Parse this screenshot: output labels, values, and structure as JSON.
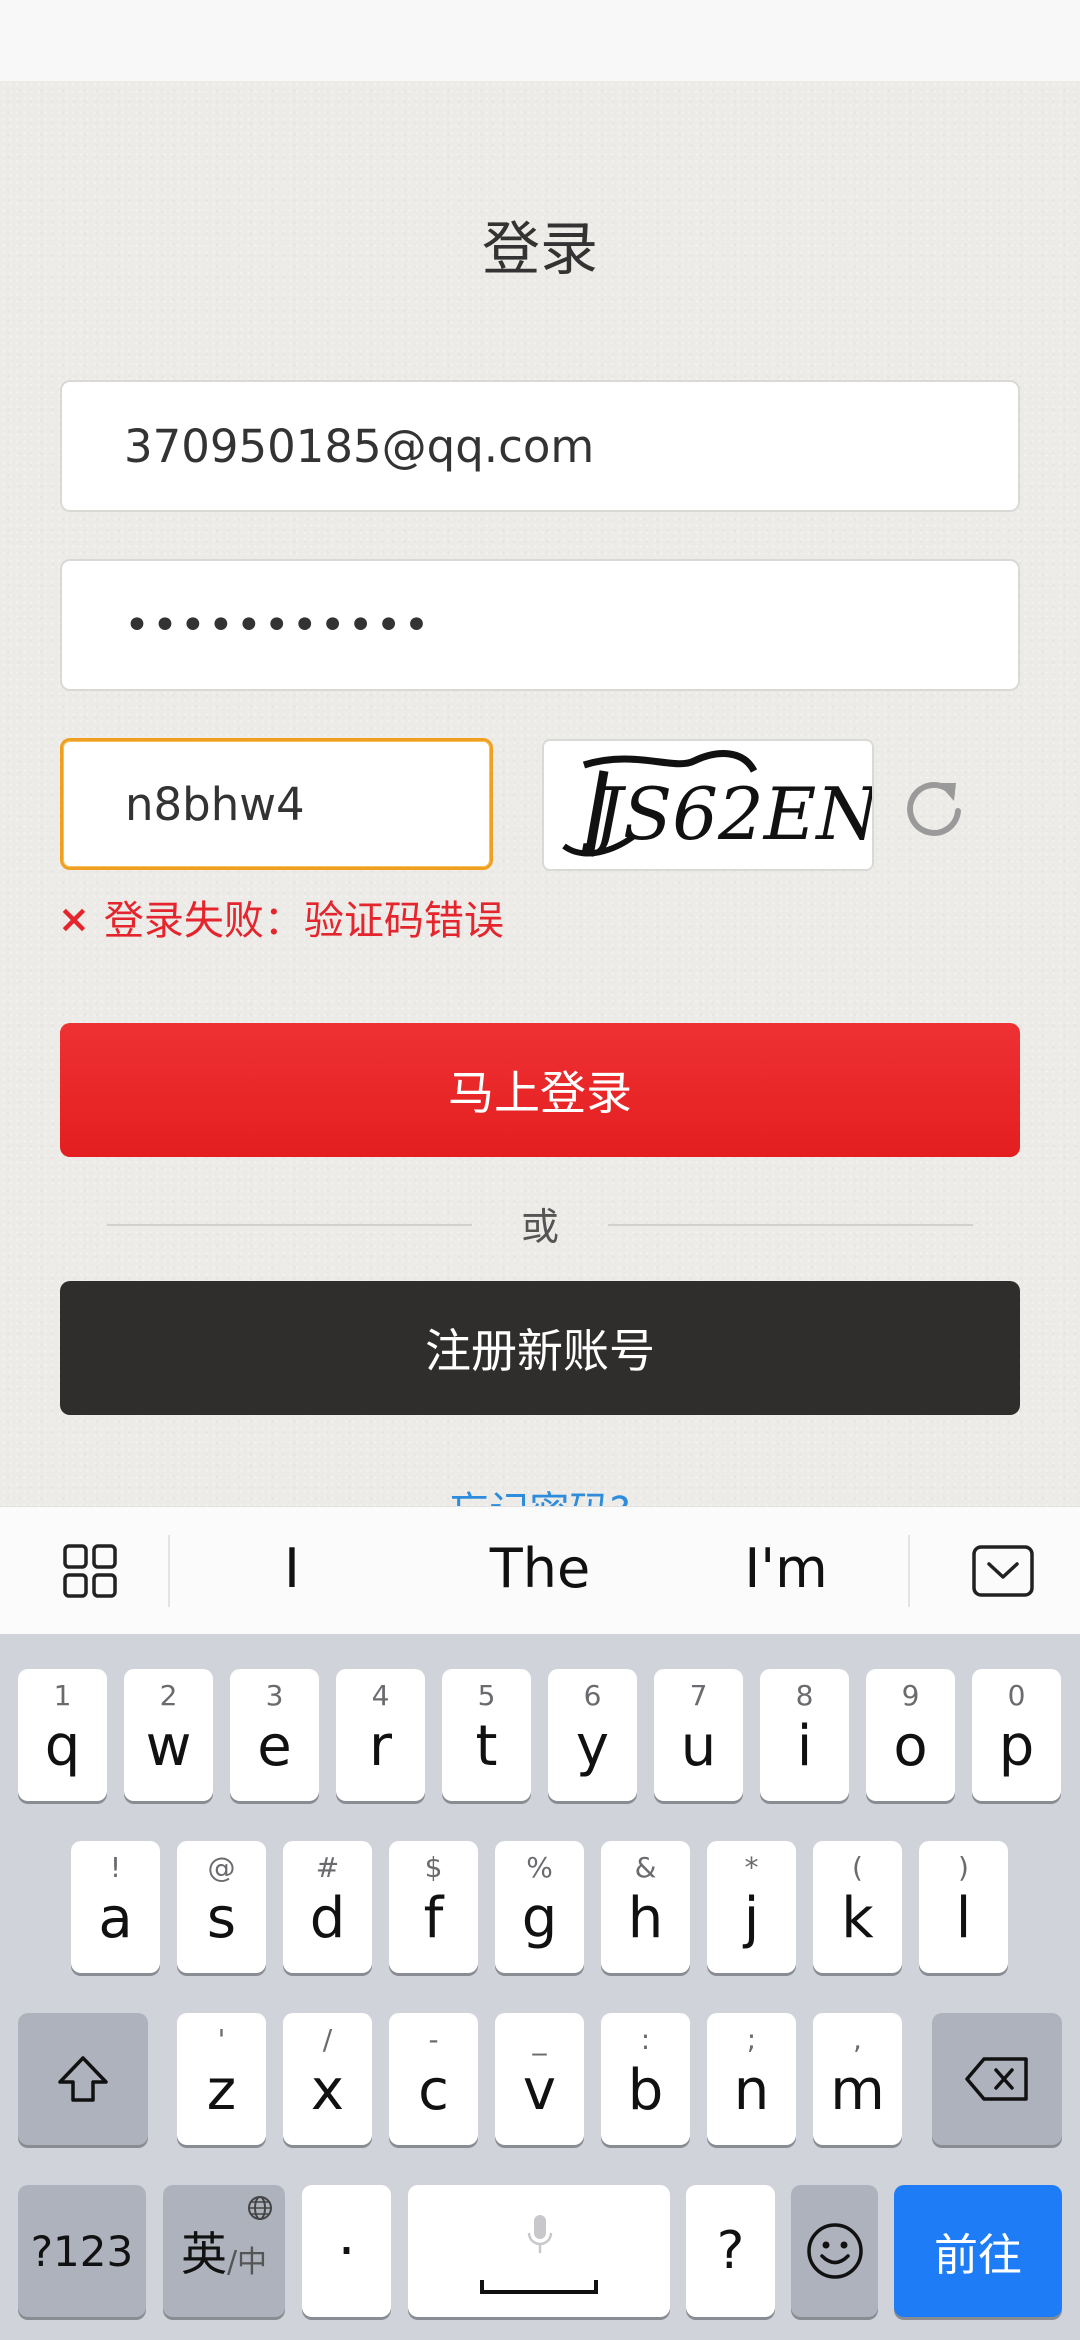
{
  "page": {
    "title": "登录",
    "email_value": "370950185@qq.com",
    "password_mask": "•••••••••••",
    "captcha_value": "n8bhw4",
    "captcha_text": "JS62EN",
    "error_mark": "×",
    "error_text": "登录失败：验证码错误",
    "login_label": "马上登录",
    "or_label": "或",
    "register_label": "注册新账号",
    "forgot_label": "忘记密码?"
  },
  "suggestions": [
    "I",
    "The",
    "I'm"
  ],
  "keyboard": {
    "row1": [
      {
        "hint": "1",
        "key": "q"
      },
      {
        "hint": "2",
        "key": "w"
      },
      {
        "hint": "3",
        "key": "e"
      },
      {
        "hint": "4",
        "key": "r"
      },
      {
        "hint": "5",
        "key": "t"
      },
      {
        "hint": "6",
        "key": "y"
      },
      {
        "hint": "7",
        "key": "u"
      },
      {
        "hint": "8",
        "key": "i"
      },
      {
        "hint": "9",
        "key": "o"
      },
      {
        "hint": "0",
        "key": "p"
      }
    ],
    "row2": [
      {
        "hint": "!",
        "key": "a"
      },
      {
        "hint": "@",
        "key": "s"
      },
      {
        "hint": "#",
        "key": "d"
      },
      {
        "hint": "$",
        "key": "f"
      },
      {
        "hint": "%",
        "key": "g"
      },
      {
        "hint": "&",
        "key": "h"
      },
      {
        "hint": "*",
        "key": "j"
      },
      {
        "hint": "(",
        "key": "k"
      },
      {
        "hint": ")",
        "key": "l"
      }
    ],
    "row3": [
      {
        "hint": "'",
        "key": "z"
      },
      {
        "hint": "/",
        "key": "x"
      },
      {
        "hint": "-",
        "key": "c"
      },
      {
        "hint": "_",
        "key": "v"
      },
      {
        "hint": ":",
        "key": "b"
      },
      {
        "hint": ";",
        "key": "n"
      },
      {
        "hint": ",",
        "key": "m"
      }
    ],
    "symbols_label": "?123",
    "lang_main": "英",
    "lang_sub": "/中",
    "dot_label": "·",
    "question_label": "?",
    "go_label": "前往"
  },
  "colors": {
    "accent_red": "#e41e20",
    "error_red": "#e5252d",
    "link_blue": "#2e8cdc",
    "go_blue": "#1e7df6"
  }
}
